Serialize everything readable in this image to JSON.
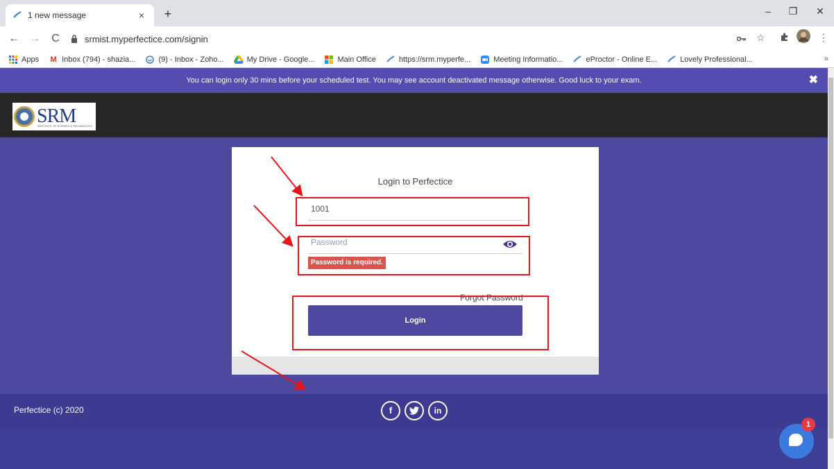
{
  "browser": {
    "tab_title": "1 new message",
    "tab_close": "×",
    "new_tab": "+",
    "url": "srmist.myperfectice.com/signin",
    "window_controls": [
      "–",
      "❐",
      "✕"
    ]
  },
  "bookmarks": {
    "items": [
      {
        "label": "Apps",
        "icon": "apps-grid-icon"
      },
      {
        "label": "Inbox (794) - shazia...",
        "icon": "gmail-icon"
      },
      {
        "label": "(9) - Inbox - Zoho...",
        "icon": "zoho-mail-icon"
      },
      {
        "label": "My Drive - Google...",
        "icon": "google-drive-icon"
      },
      {
        "label": "Main Office",
        "icon": "office-icon"
      },
      {
        "label": "https://srm.myperfe...",
        "icon": "perfectice-icon"
      },
      {
        "label": "Meeting Informatio...",
        "icon": "zoom-icon"
      },
      {
        "label": "eProctor - Online E...",
        "icon": "perfectice-icon"
      },
      {
        "label": "Lovely Professional...",
        "icon": "perfectice-icon"
      }
    ],
    "more": "»"
  },
  "notice": {
    "text": "You can login only 30 mins before your scheduled test. You may see account deactivated message otherwise. Good luck to your exam.",
    "close": "✖"
  },
  "logo": {
    "text": "SRM",
    "tagline": "INSTITUTE OF SCIENCE & TECHNOLOGY"
  },
  "login": {
    "title": "Login to Perfectice",
    "username_value": "1001",
    "password_placeholder": "Password",
    "error": "Password is required.",
    "forgot": "Forgot Password",
    "button": "Login"
  },
  "footer": {
    "copyright": "Perfectice (c) 2020",
    "social": [
      "f",
      "t",
      "in"
    ]
  },
  "chat": {
    "badge": "1"
  },
  "colors": {
    "page_bg": "#3d3f97",
    "brand_purple": "#4d499f",
    "annotation_red": "#e8141b",
    "error_red": "#d9534f"
  }
}
